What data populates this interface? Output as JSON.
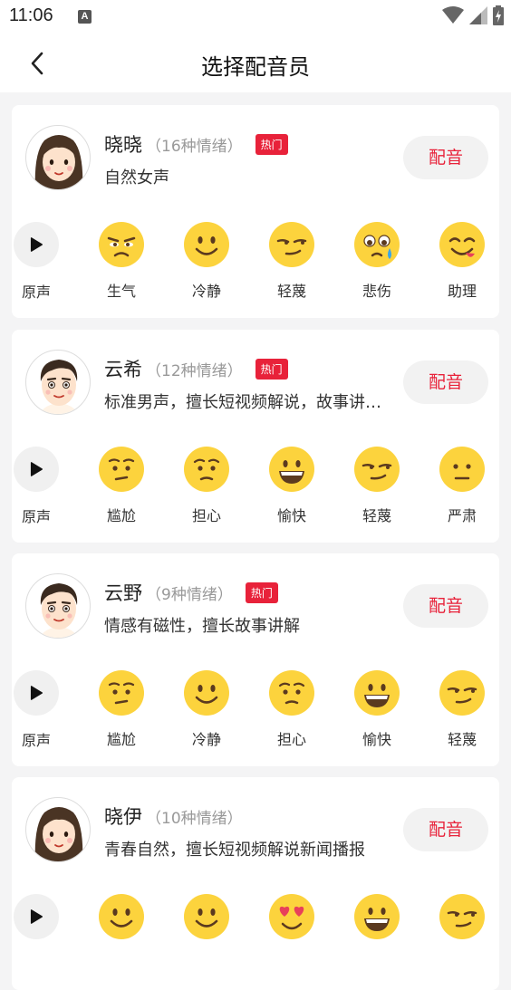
{
  "status": {
    "time": "11:06",
    "notify_letter": "A"
  },
  "nav": {
    "title": "选择配音员"
  },
  "voices": [
    {
      "name": "晓晓",
      "emotion_count": "（16种情绪）",
      "badge": "热门",
      "desc": "自然女声",
      "avatar": "female",
      "button": "配音",
      "emotions": [
        {
          "label": "原声",
          "icon": "play-icon"
        },
        {
          "label": "生气",
          "icon": "angry-face-icon"
        },
        {
          "label": "冷静",
          "icon": "calm-face-icon"
        },
        {
          "label": "轻蔑",
          "icon": "smirk-face-icon"
        },
        {
          "label": "悲伤",
          "icon": "sad-face-icon"
        },
        {
          "label": "助理",
          "icon": "tongue-face-icon"
        }
      ]
    },
    {
      "name": "云希",
      "emotion_count": "（12种情绪）",
      "badge": "热门",
      "desc": "标准男声，擅长短视频解说，故事讲…",
      "avatar": "male",
      "button": "配音",
      "emotions": [
        {
          "label": "原声",
          "icon": "play-icon"
        },
        {
          "label": "尴尬",
          "icon": "awkward-face-icon"
        },
        {
          "label": "担心",
          "icon": "worried-face-icon"
        },
        {
          "label": "愉快",
          "icon": "grin-face-icon"
        },
        {
          "label": "轻蔑",
          "icon": "smirk-face-icon"
        },
        {
          "label": "严肃",
          "icon": "serious-face-icon"
        }
      ]
    },
    {
      "name": "云野",
      "emotion_count": "（9种情绪）",
      "badge": "热门",
      "desc": "情感有磁性，擅长故事讲解",
      "avatar": "male",
      "button": "配音",
      "emotions": [
        {
          "label": "原声",
          "icon": "play-icon"
        },
        {
          "label": "尴尬",
          "icon": "awkward-face-icon"
        },
        {
          "label": "冷静",
          "icon": "calm-face-icon"
        },
        {
          "label": "担心",
          "icon": "worried-face-icon"
        },
        {
          "label": "愉快",
          "icon": "grin-face-icon"
        },
        {
          "label": "轻蔑",
          "icon": "smirk-face-icon"
        }
      ]
    },
    {
      "name": "晓伊",
      "emotion_count": "（10种情绪）",
      "badge": "",
      "desc": "青春自然，擅长短视频解说新闻播报",
      "avatar": "female",
      "button": "配音",
      "emotions": [
        {
          "label": "",
          "icon": "play-icon"
        },
        {
          "label": "",
          "icon": "calm-face-icon"
        },
        {
          "label": "",
          "icon": "calm-face-icon"
        },
        {
          "label": "",
          "icon": "heart-eyes-face-icon"
        },
        {
          "label": "",
          "icon": "grin-face-icon"
        },
        {
          "label": "",
          "icon": "smirk-face-icon"
        }
      ]
    }
  ],
  "colors": {
    "accent": "#e8223a",
    "emoji_yellow": "#fcd33d",
    "emoji_dark": "#5b3a1f",
    "background": "#f4f4f5"
  }
}
